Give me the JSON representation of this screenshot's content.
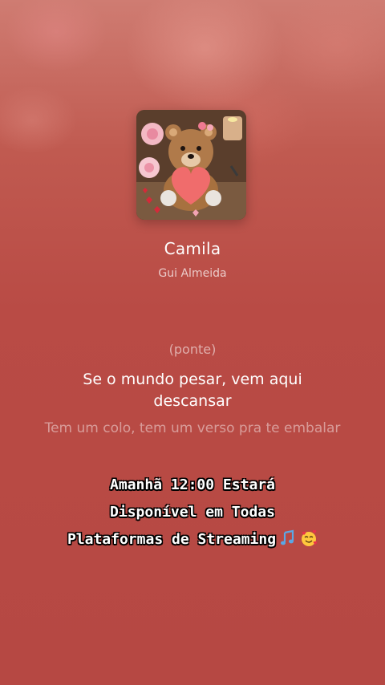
{
  "song": {
    "title": "Camila",
    "artist": "Gui Almeida",
    "cover_icon": "teddy-bear-heart-artwork"
  },
  "lyrics": {
    "section_tag": "(ponte)",
    "current_line": "Se o mundo pesar, vem aqui descansar",
    "next_line": "Tem um colo, tem um verso pra te embalar"
  },
  "overlay": {
    "line1": "Amanhã 12:00 Estará",
    "line2": "Disponível em Todas",
    "line3": "Plataformas de Streaming",
    "emoji_icons": [
      "music-notes-icon",
      "smiling-hearts-icon"
    ]
  },
  "colors": {
    "background": "#b84a44",
    "text": "#ffffff"
  }
}
